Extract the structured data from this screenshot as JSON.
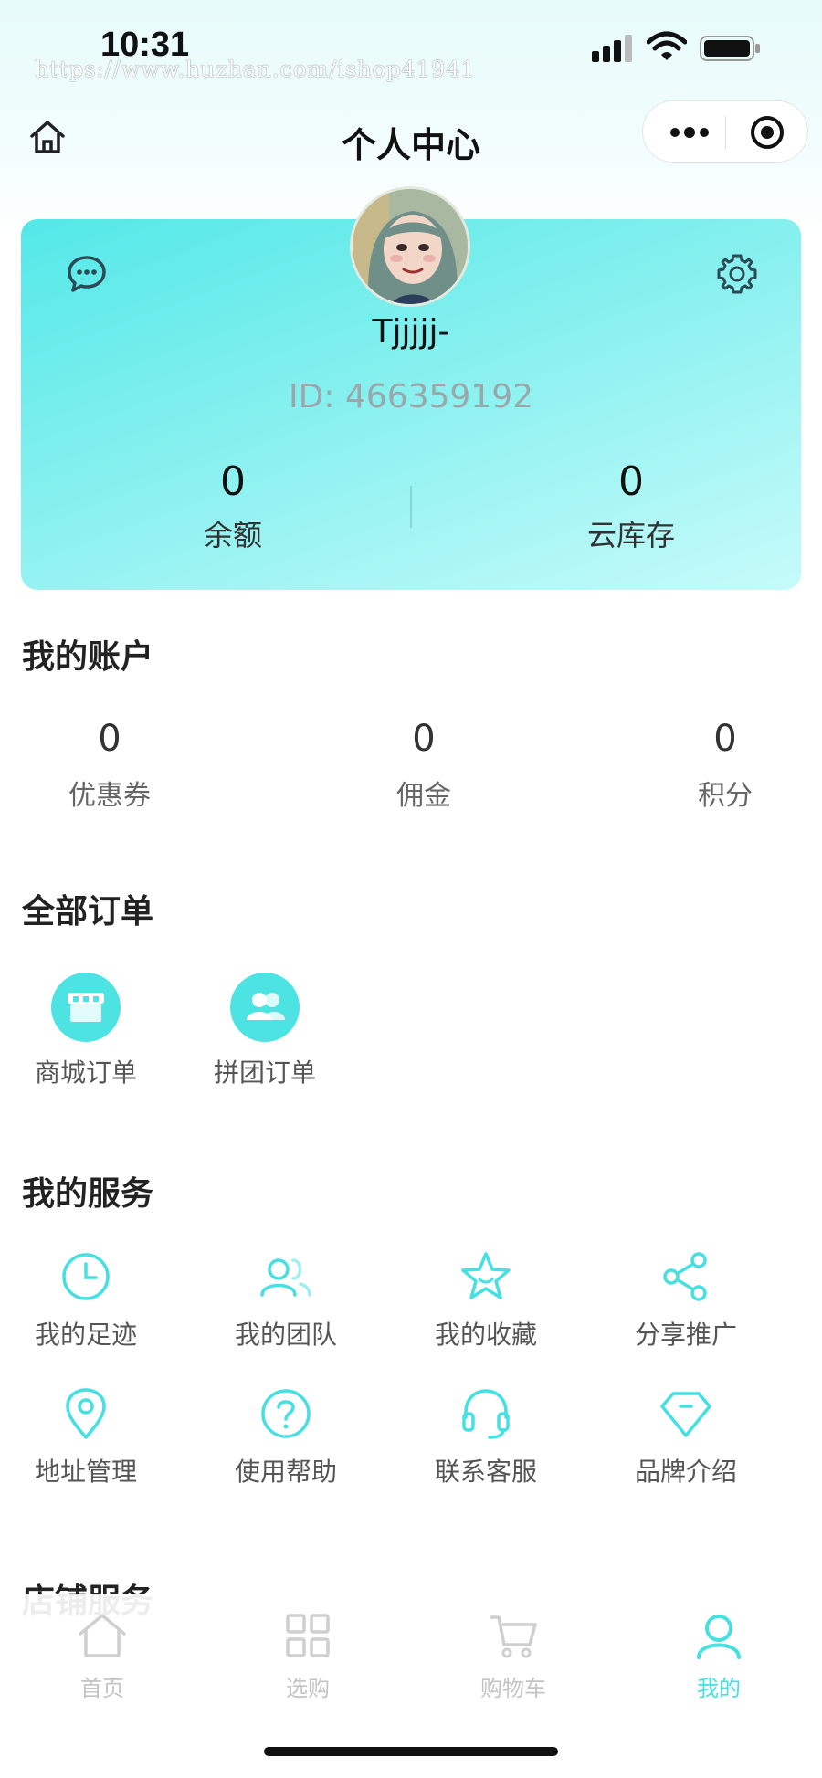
{
  "status_bar": {
    "time": "10:31",
    "watermark": "https://www.huzhan.com/ishop41941"
  },
  "nav": {
    "title": "个人中心"
  },
  "profile": {
    "username": "Tjjjjj-",
    "user_id": "ID: 466359192",
    "stats": [
      {
        "value": "0",
        "label": "余额"
      },
      {
        "value": "0",
        "label": "云库存"
      }
    ]
  },
  "account": {
    "title": "我的账户",
    "items": [
      {
        "value": "0",
        "label": "优惠券"
      },
      {
        "value": "0",
        "label": "佣金"
      },
      {
        "value": "0",
        "label": "积分"
      }
    ]
  },
  "orders": {
    "title": "全部订单",
    "items": [
      {
        "label": "商城订单",
        "icon": "store-icon"
      },
      {
        "label": "拼团订单",
        "icon": "group-icon"
      }
    ]
  },
  "services": {
    "title": "我的服务",
    "items": [
      {
        "label": "我的足迹",
        "icon": "clock-icon"
      },
      {
        "label": "我的团队",
        "icon": "team-icon"
      },
      {
        "label": "我的收藏",
        "icon": "star-icon"
      },
      {
        "label": "分享推广",
        "icon": "share-icon"
      },
      {
        "label": "地址管理",
        "icon": "location-icon"
      },
      {
        "label": "使用帮助",
        "icon": "help-icon"
      },
      {
        "label": "联系客服",
        "icon": "headset-icon"
      },
      {
        "label": "品牌介绍",
        "icon": "diamond-icon"
      }
    ]
  },
  "shop_services": {
    "title": "店铺服务"
  },
  "tabs": [
    {
      "label": "首页",
      "icon": "home-icon"
    },
    {
      "label": "选购",
      "icon": "grid-icon"
    },
    {
      "label": "购物车",
      "icon": "cart-icon"
    },
    {
      "label": "我的",
      "icon": "user-icon",
      "active": true
    }
  ],
  "colors": {
    "accent": "#46dfe2",
    "card_start": "#53e8e8",
    "card_end": "#c6fbfa"
  }
}
